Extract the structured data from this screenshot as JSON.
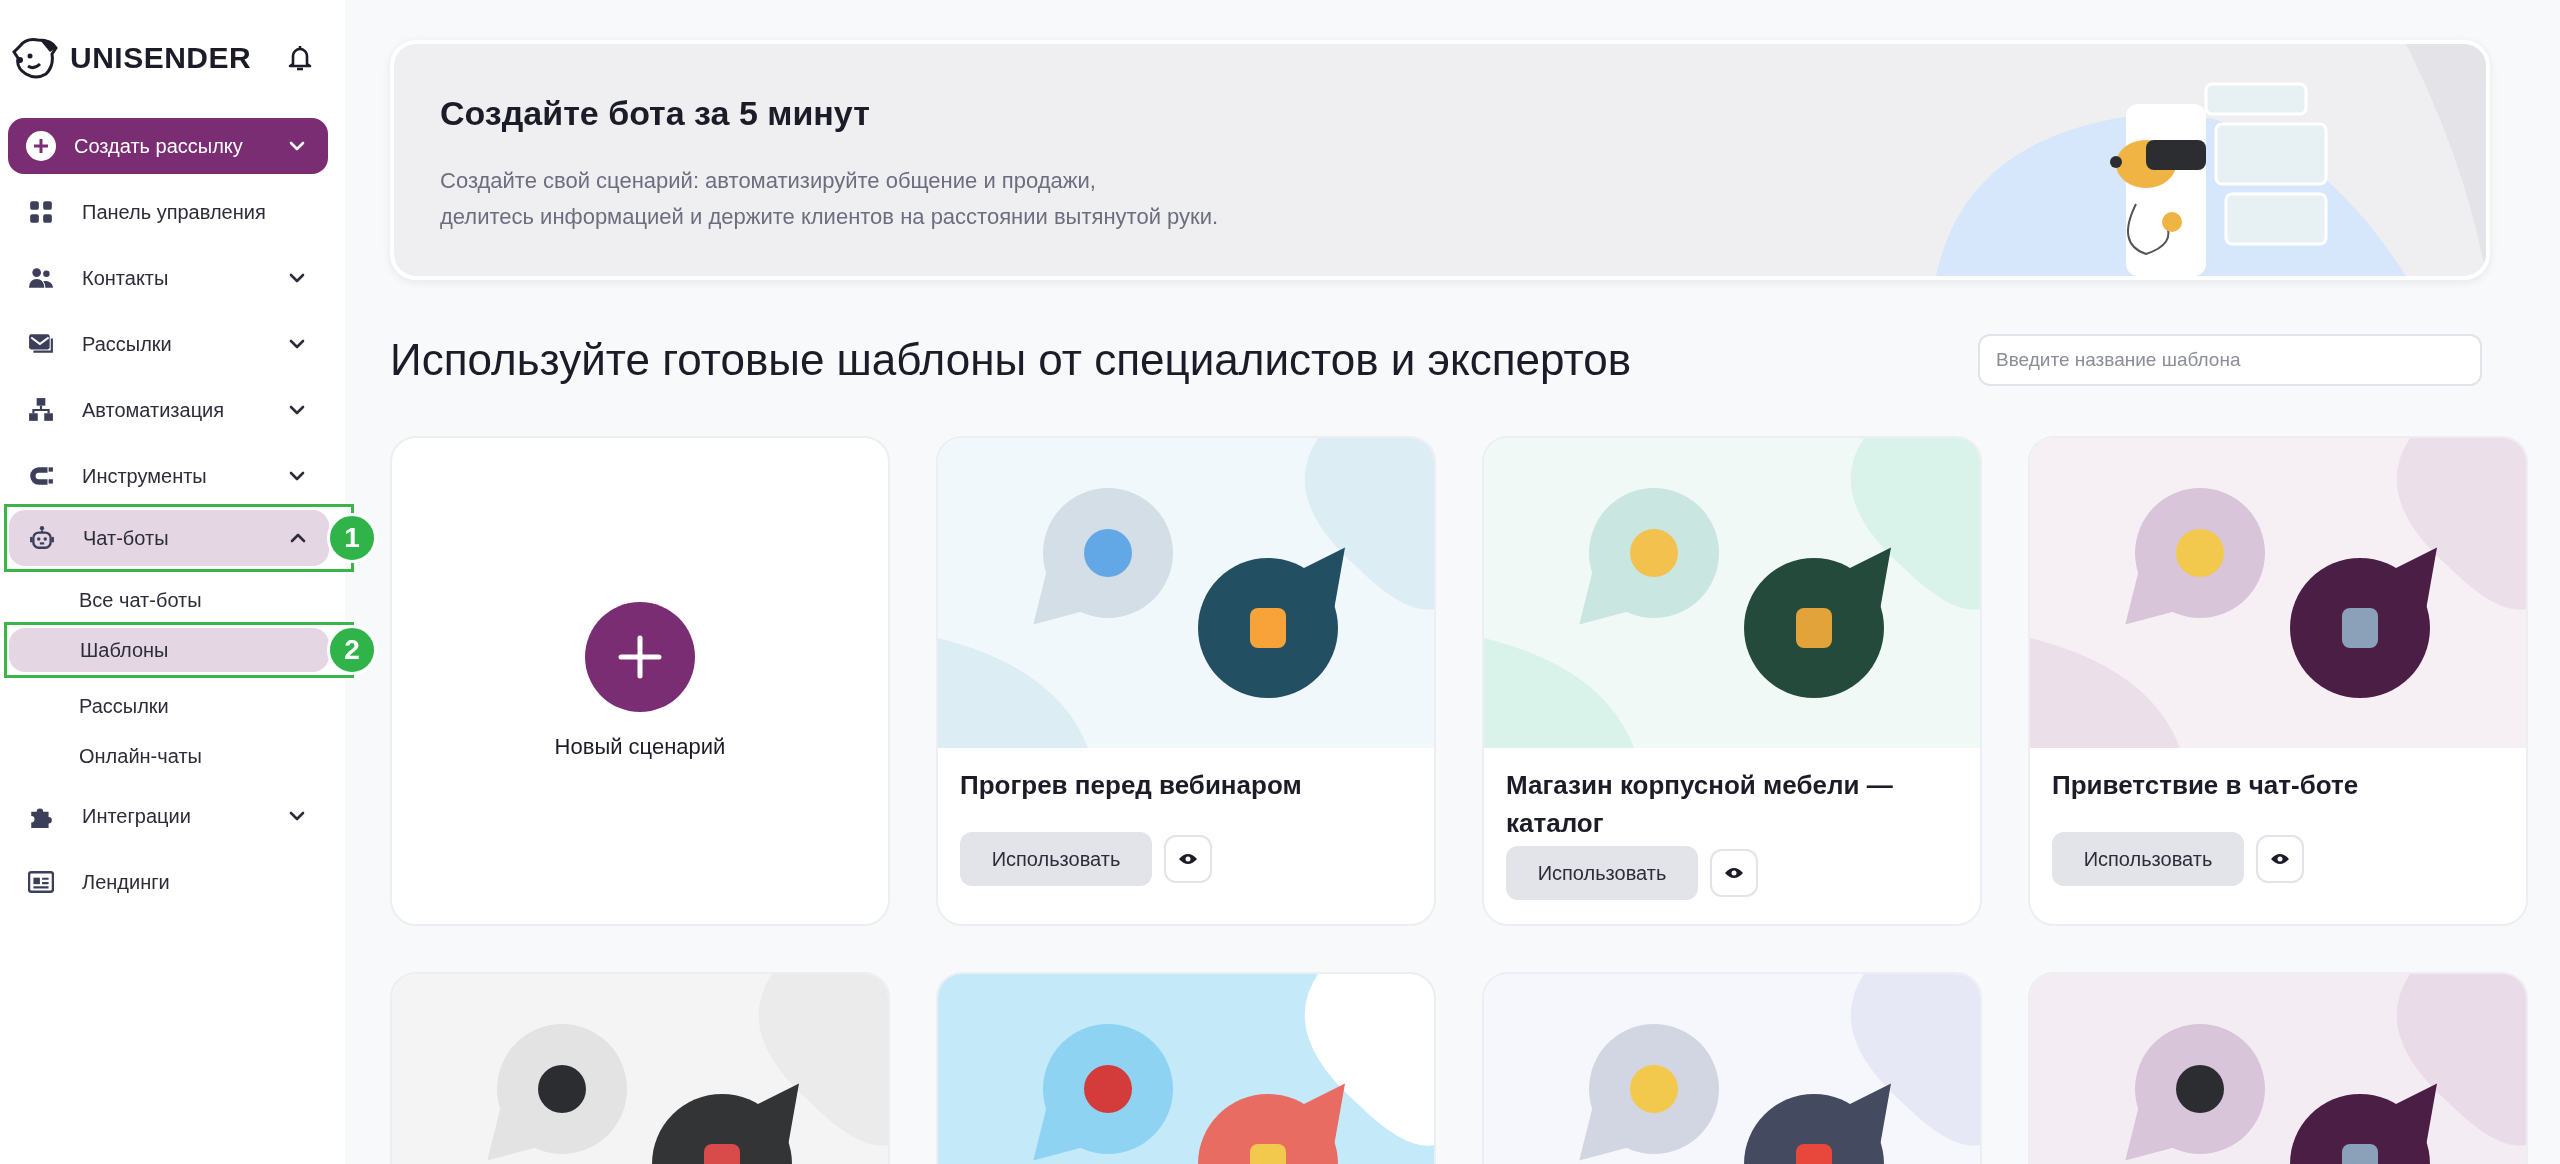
{
  "sidebar": {
    "logo": "UNISENDER",
    "create_button": "Создать рассылку",
    "items": [
      {
        "label": "Панель управления",
        "selected": false
      },
      {
        "label": "Контакты",
        "selected": false,
        "expanded": false
      },
      {
        "label": "Рассылки",
        "selected": false,
        "expanded": false
      },
      {
        "label": "Автоматизация",
        "selected": false,
        "expanded": false
      },
      {
        "label": "Инструменты",
        "selected": false,
        "expanded": false
      },
      {
        "label": "Чат-боты",
        "selected": true,
        "expanded": true,
        "annotation": "1",
        "children": [
          {
            "label": "Все чат-боты",
            "selected": false
          },
          {
            "label": "Шаблоны",
            "selected": true,
            "annotation": "2"
          },
          {
            "label": "Рассылки",
            "selected": false
          },
          {
            "label": "Онлайн-чаты",
            "selected": false
          }
        ]
      },
      {
        "label": "Интеграции",
        "selected": false,
        "expanded": false
      },
      {
        "label": "Лендинги",
        "selected": false
      }
    ]
  },
  "banner": {
    "title": "Создайте бота за 5 минут",
    "lines": [
      "Создайте свой сценарий: автоматизируйте общение и продажи,",
      "делитесь информацией и держите клиентов на расстоянии вытянутой руки."
    ]
  },
  "templates": {
    "title": "Используйте готовые шаблоны от специалистов и экспертов",
    "search": {
      "placeholder": "Введите название шаблона"
    },
    "cards": [
      {
        "kind": "new",
        "label": "Новый сценарий"
      },
      {
        "kind": "template",
        "title": "Прогрев перед вебинаром",
        "button": "Использовать"
      },
      {
        "kind": "template",
        "title": "Магазин корпусной мебели — каталог",
        "button": "Использовать"
      },
      {
        "kind": "template",
        "title": "Приветствие в чат-боте",
        "button": "Использовать"
      },
      {
        "kind": "template"
      },
      {
        "kind": "template"
      },
      {
        "kind": "template"
      },
      {
        "kind": "template"
      }
    ]
  }
}
